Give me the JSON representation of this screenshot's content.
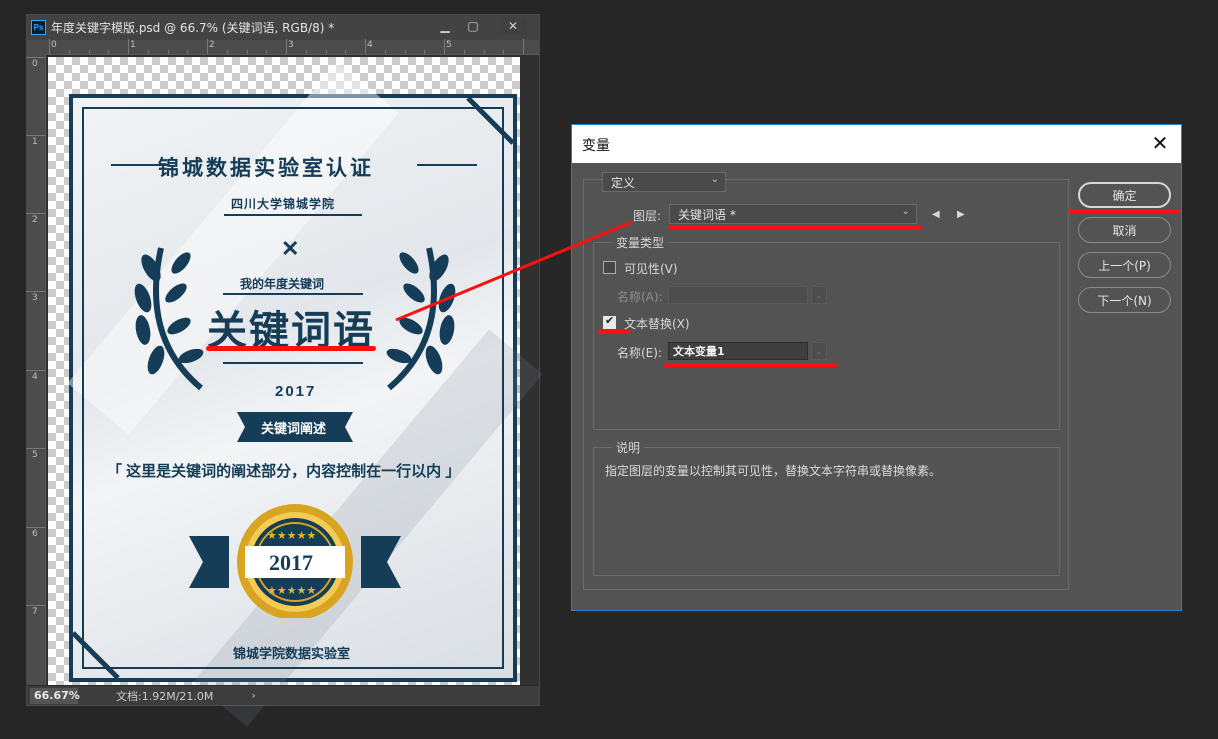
{
  "document": {
    "app_icon": "Ps",
    "title": "年度关键字模版.psd @ 66.7% (关键词语, RGB/8) *",
    "window_buttons": {
      "minimize": "▁",
      "maximize": "▢",
      "close": "✕"
    },
    "ruler_h": [
      "0",
      "1",
      "2",
      "3",
      "4",
      "5"
    ],
    "ruler_v": [
      "0",
      "1",
      "2",
      "3",
      "4",
      "5",
      "6",
      "7"
    ],
    "status": {
      "zoom": "66.67%",
      "doc_info": "文档:1.92M/21.0M",
      "arrow": "›"
    }
  },
  "artwork": {
    "heading": "锦城数据实验室认证",
    "school": "四川大学锦城学院",
    "subtitle": "我的年度关键词",
    "keyword": "关键词语",
    "year": "2017",
    "ribbon": "关键词阐述",
    "description": "「 这里是关键词的阐述部分，内容控制在一行以内 」",
    "badge_year": "2017",
    "footer": "锦城学院数据实验室",
    "colors": {
      "navy": "#153d57",
      "gold": "#d9a521"
    }
  },
  "dialog": {
    "title": "变量",
    "close": "✕",
    "definition_dropdown": "定义",
    "layer_label": "图层:",
    "layer_value": "关键词语 *",
    "prev_arrow": "◀",
    "next_arrow": "▶",
    "var_type_legend": "变量类型",
    "visibility": {
      "label": "可见性(V)",
      "checked": false,
      "name_label": "名称(A):",
      "name_value": ""
    },
    "text_replace": {
      "label": "文本替换(X)",
      "checked": true,
      "name_label": "名称(E):",
      "name_value": "文本变量1"
    },
    "desc_legend": "说明",
    "desc_text": "指定图层的变量以控制其可见性，替换文本字符串或替换像素。",
    "buttons": {
      "ok": "确定",
      "cancel": "取消",
      "prev": "上一个(P)",
      "next": "下一个(N)"
    }
  },
  "annotation_color": "#ff1010"
}
